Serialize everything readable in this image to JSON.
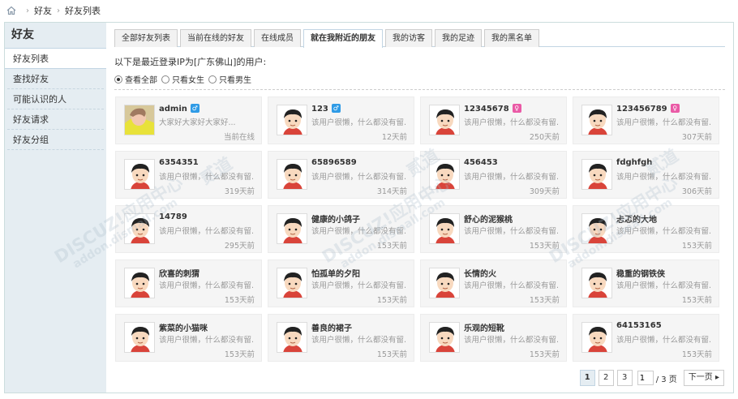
{
  "breadcrumb": {
    "items": [
      "好友",
      "好友列表"
    ]
  },
  "sidebar": {
    "title": "好友",
    "items": [
      {
        "label": "好友列表"
      },
      {
        "label": "查找好友"
      },
      {
        "label": "可能认识的人"
      },
      {
        "label": "好友请求"
      },
      {
        "label": "好友分组"
      }
    ]
  },
  "tabs": [
    {
      "label": "全部好友列表"
    },
    {
      "label": "当前在线的好友"
    },
    {
      "label": "在线成员"
    },
    {
      "label": "就在我附近的朋友"
    },
    {
      "label": "我的访客"
    },
    {
      "label": "我的足迹"
    },
    {
      "label": "我的黑名单"
    }
  ],
  "note": "以下是最近登录IP为[广东佛山]的用户:",
  "filters": [
    {
      "label": "查看全部"
    },
    {
      "label": "只看女生"
    },
    {
      "label": "只看男生"
    }
  ],
  "users": [
    {
      "name": "admin",
      "gender": "male",
      "sig": "大家好大家好大家好...",
      "time": "当前在线",
      "avatar": "custom"
    },
    {
      "name": "123",
      "gender": "male",
      "sig": "该用户很懒，什么都没有留...",
      "time": "12天前"
    },
    {
      "name": "12345678",
      "gender": "female",
      "sig": "该用户很懒，什么都没有留...",
      "time": "250天前"
    },
    {
      "name": "123456789",
      "gender": "female",
      "sig": "该用户很懒，什么都没有留...",
      "time": "307天前"
    },
    {
      "name": "6354351",
      "sig": "该用户很懒，什么都没有留...",
      "time": "319天前"
    },
    {
      "name": "65896589",
      "sig": "该用户很懒，什么都没有留...",
      "time": "314天前"
    },
    {
      "name": "456453",
      "sig": "该用户很懒，什么都没有留...",
      "time": "309天前"
    },
    {
      "name": "fdghfgh",
      "sig": "该用户很懒，什么都没有留...",
      "time": "306天前"
    },
    {
      "name": "14789",
      "sig": "该用户很懒，什么都没有留...",
      "time": "295天前"
    },
    {
      "name": "健康的小鸽子",
      "sig": "该用户很懒，什么都没有留...",
      "time": "153天前"
    },
    {
      "name": "舒心的泥猴桃",
      "sig": "该用户很懒，什么都没有留...",
      "time": "153天前"
    },
    {
      "name": "忐忑的大地",
      "sig": "该用户很懒，什么都没有留...",
      "time": "153天前"
    },
    {
      "name": "欣喜的刺猬",
      "sig": "该用户很懒，什么都没有留...",
      "time": "153天前"
    },
    {
      "name": "怕孤单的夕阳",
      "sig": "该用户很懒，什么都没有留...",
      "time": "153天前"
    },
    {
      "name": "长情的火",
      "sig": "该用户很懒，什么都没有留...",
      "time": "153天前"
    },
    {
      "name": "稳重的钢铁侠",
      "sig": "该用户很懒，什么都没有留...",
      "time": "153天前"
    },
    {
      "name": "紫菜的小猫咪",
      "sig": "该用户很懒，什么都没有留...",
      "time": "153天前"
    },
    {
      "name": "善良的裙子",
      "sig": "该用户很懒，什么都没有留...",
      "time": "153天前"
    },
    {
      "name": "乐观的短靴",
      "sig": "该用户很懒，什么都没有留...",
      "time": "153天前"
    },
    {
      "name": "64153165",
      "sig": "该用户很懒，什么都没有留...",
      "time": "153天前"
    }
  ],
  "gender_symbols": {
    "male": "♂",
    "female": "♀"
  },
  "pager": {
    "pages": [
      "1",
      "2",
      "3"
    ],
    "current": "1",
    "input_value": "1",
    "total": "/ 3 页",
    "next": "下一页 ▸"
  },
  "watermark": [
    "DISCUZ!应用中心",
    "addon.dismall.com",
    "贰道"
  ],
  "colors": {
    "sidebar_bg": "#e5edf2",
    "male": "#2f9be6",
    "female": "#ea5aa6"
  }
}
